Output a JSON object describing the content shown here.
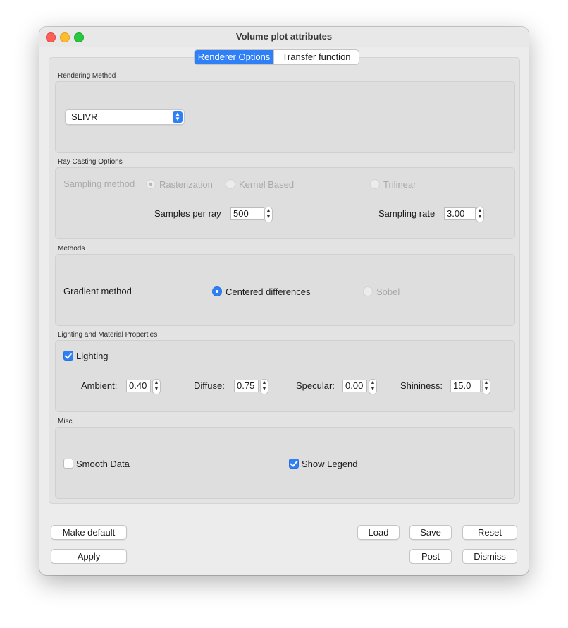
{
  "window": {
    "title": "Volume plot attributes"
  },
  "tabs": [
    {
      "label": "Renderer Options",
      "active": true
    },
    {
      "label": "Transfer function",
      "active": false
    }
  ],
  "rendering_method": {
    "group_label": "Rendering Method",
    "selected": "SLIVR"
  },
  "ray_casting": {
    "group_label": "Ray Casting Options",
    "sampling_method_label": "Sampling method",
    "options": [
      "Rasterization",
      "Kernel Based",
      "Trilinear"
    ],
    "selected_option": "Rasterization",
    "samples_per_ray_label": "Samples per ray",
    "samples_per_ray_value": "500",
    "sampling_rate_label": "Sampling rate",
    "sampling_rate_value": "3.00"
  },
  "methods": {
    "group_label": "Methods",
    "gradient_label": "Gradient method",
    "options": [
      "Centered differences",
      "Sobel"
    ],
    "selected_option": "Centered differences"
  },
  "lighting": {
    "group_label": "Lighting and Material Properties",
    "lighting_label": "Lighting",
    "lighting_checked": true,
    "ambient_label": "Ambient:",
    "ambient_value": "0.40",
    "diffuse_label": "Diffuse:",
    "diffuse_value": "0.75",
    "specular_label": "Specular:",
    "specular_value": "0.00",
    "shininess_label": "Shininess:",
    "shininess_value": "15.0"
  },
  "misc": {
    "group_label": "Misc",
    "smooth_label": "Smooth Data",
    "smooth_checked": false,
    "legend_label": "Show Legend",
    "legend_checked": true
  },
  "buttons": {
    "make_default": "Make default",
    "apply": "Apply",
    "load": "Load",
    "save": "Save",
    "reset": "Reset",
    "post": "Post",
    "dismiss": "Dismiss"
  },
  "colors": {
    "accent": "#2f7ff6",
    "window_bg": "#ececec"
  }
}
